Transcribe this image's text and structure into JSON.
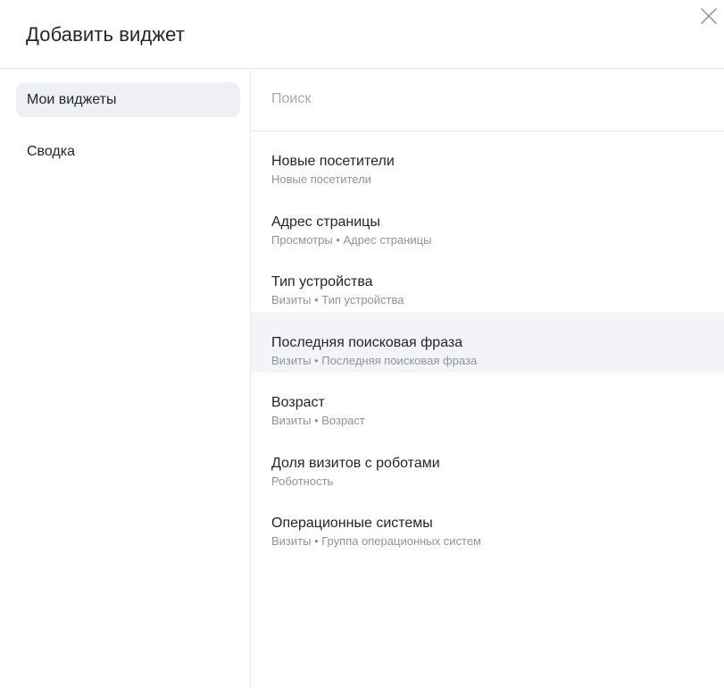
{
  "dialog": {
    "title": "Добавить виджет",
    "close_icon": "close-icon"
  },
  "sidebar": {
    "items": [
      {
        "label": "Мои виджеты",
        "active": true
      },
      {
        "label": "Сводка",
        "active": false
      }
    ]
  },
  "search": {
    "placeholder": "Поиск",
    "value": ""
  },
  "widgets": [
    {
      "title": "Новые посетители",
      "subtitle": "Новые посетители"
    },
    {
      "title": "Адрес страницы",
      "subtitle": "Просмотры • Адрес страницы"
    },
    {
      "title": "Тип устройства",
      "subtitle": "Визиты • Тип устройства"
    },
    {
      "title": "Последняя поисковая фраза",
      "subtitle": "Визиты • Последняя поисковая фраза",
      "hovered": true
    },
    {
      "title": "Возраст",
      "subtitle": "Визиты • Возраст"
    },
    {
      "title": "Доля визитов с роботами",
      "subtitle": "Роботность"
    },
    {
      "title": "Операционные системы",
      "subtitle": "Визиты • Группа операционных систем"
    }
  ],
  "colors": {
    "text": "#21252d",
    "muted": "#8f939c",
    "placeholder": "#a6a9b0",
    "active_bg": "#eef0f4",
    "hover_bg": "#f3f4f7",
    "divider": "#e8e9ec"
  }
}
